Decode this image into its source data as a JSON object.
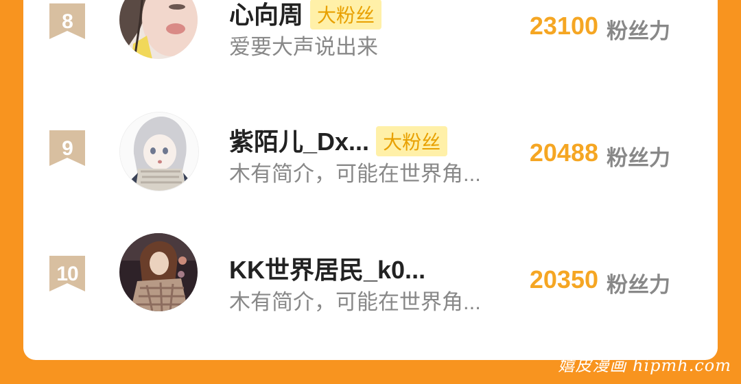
{
  "ranking": {
    "unit_label": "粉丝力",
    "rows": [
      {
        "rank": "8",
        "name": "心向周",
        "tag": "大粉丝",
        "bio": "爱要大声说出来",
        "score": "23100",
        "unit": "粉丝力",
        "avatar": "photo"
      },
      {
        "rank": "9",
        "name": "紫陌儿_Dx...",
        "tag": "大粉丝",
        "bio": "木有简介，可能在世界角...",
        "score": "20488",
        "unit": "粉丝力",
        "avatar": "anime"
      },
      {
        "rank": "10",
        "name": "KK世界居民_k0...",
        "tag": "",
        "bio": "木有简介，可能在世界角...",
        "score": "20350",
        "unit": "粉丝力",
        "avatar": "art"
      }
    ]
  },
  "watermark": "嬉皮漫画 hipmh.com",
  "colors": {
    "background": "#F8941F",
    "card": "#FFFFFF",
    "badge": "#D8BFA0",
    "score": "#F5A623",
    "tag_bg": "#FFF0A8",
    "tag_text": "#E8A000"
  }
}
